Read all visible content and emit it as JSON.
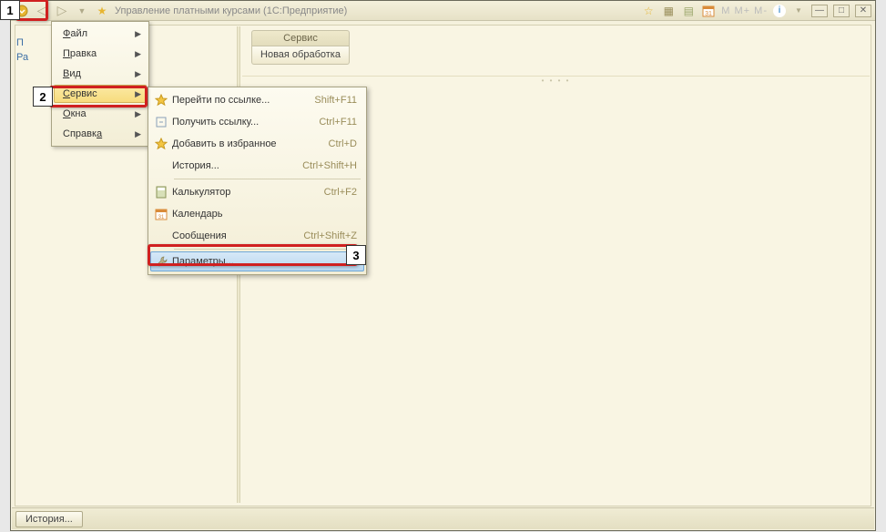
{
  "titlebar": {
    "title": "Управление платными курсами  (1С:Предприятие)",
    "m_buttons": "M  M+  M-"
  },
  "sidebar": {
    "line1": "П",
    "line2": "Ра"
  },
  "service_box": {
    "title": "Сервис",
    "button": "Новая обработка"
  },
  "main_menu": {
    "items": [
      {
        "label": "Файл"
      },
      {
        "label": "Правка"
      },
      {
        "label": "Вид"
      },
      {
        "label": "Сервис"
      },
      {
        "label": "Окна"
      },
      {
        "label": "Справка"
      }
    ]
  },
  "sub_menu": {
    "items": [
      {
        "label": "Перейти по ссылке...",
        "shortcut": "Shift+F11",
        "icon": "star"
      },
      {
        "label": "Получить ссылку...",
        "shortcut": "Ctrl+F11",
        "icon": "link"
      },
      {
        "label": "Добавить в избранное",
        "shortcut": "Ctrl+D",
        "icon": "star"
      },
      {
        "label": "История...",
        "shortcut": "Ctrl+Shift+H",
        "icon": ""
      },
      {
        "label": "Калькулятор",
        "shortcut": "Ctrl+F2",
        "icon": "calc"
      },
      {
        "label": "Календарь",
        "shortcut": "",
        "icon": "cal"
      },
      {
        "label": "Сообщения",
        "shortcut": "Ctrl+Shift+Z",
        "icon": ""
      },
      {
        "label": "Параметры...",
        "shortcut": "",
        "icon": "wrench"
      }
    ]
  },
  "callouts": {
    "c1": "1",
    "c2": "2",
    "c3": "3"
  },
  "statusbar": {
    "history": "История..."
  }
}
